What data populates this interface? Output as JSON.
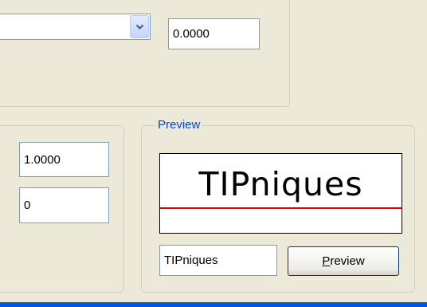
{
  "top_group": {
    "combo_value": "",
    "offset_value": "0.0000"
  },
  "left_group": {
    "scale_value": "1.0000",
    "angle_value": "0"
  },
  "preview_group": {
    "legend": "Preview",
    "preview_text": "TIPniques",
    "sample_text_value": "TIPniques",
    "preview_button_mnemonic": "P",
    "preview_button_rest": "review",
    "baseline_color": "#e00000"
  },
  "icons": {
    "combo_dropdown": "chevron-down-icon"
  },
  "colors": {
    "dialog_background": "#ece9d8",
    "legend_text": "#0046d5",
    "field_border": "#7f9db9",
    "taskbar_blue": "#0055e5"
  }
}
